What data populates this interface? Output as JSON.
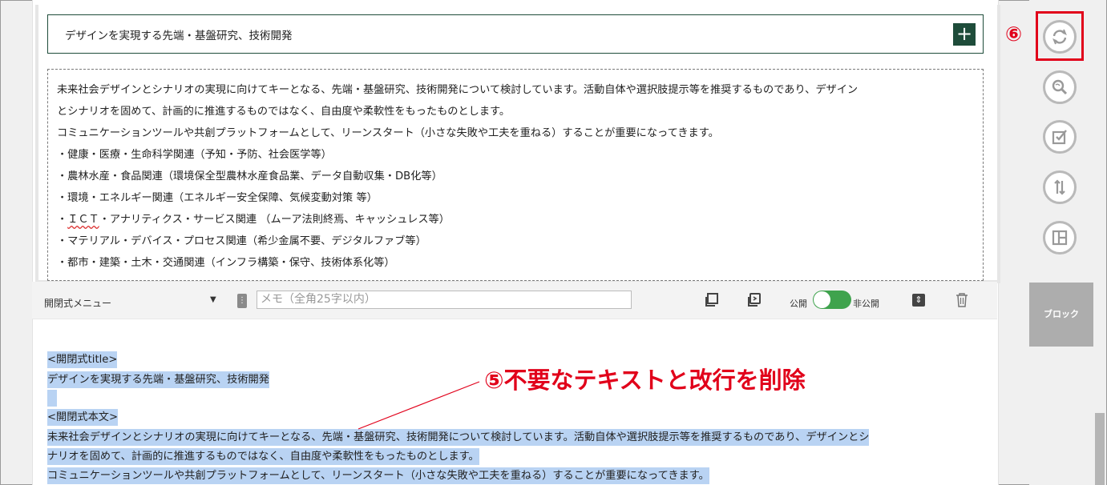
{
  "accordion": {
    "title": "デザインを実現する先端・基盤研究、技術開発",
    "expand_icon": "+",
    "body_lines": [
      "未来社会デザインとシナリオの実現に向けてキーとなる、先端・基盤研究、技術開発について検討しています。活動自体や選択肢提示等を推奨するものであり、デザイン",
      "とシナリオを固めて、計画的に推進するものではなく、自由度や柔軟性をもったものとします。",
      "コミュニケーションツールや共創プラットフォームとして、リーンスタート（小さな失敗や工夫を重ねる）することが重要になってきます。",
      "・健康・医療・生命科学関連（予知・予防、社会医学等）",
      "・農林水産・食品関連（環境保全型農林水産食品業、データ自動収集・DB化等）",
      "・環境・エネルギー関連（エネルギー安全保障、気候変動対策 等）"
    ],
    "ict_line": {
      "prefix": "・",
      "underlined": "ＩＣＴ",
      "rest": "・アナリティクス・サービス関連 （ムーア法則終焉、キャッシュレス等）"
    },
    "body_lines_after": [
      "・マテリアル・デバイス・プロセス関連（希少金属不要、デジタルファブ等）",
      "・都市・建築・土木・交通関連（インフラ構築・保守、技術体系化等）"
    ]
  },
  "toolbar": {
    "block_type": "開閉式メニュー",
    "memo_placeholder": "メモ（全角25字以内）",
    "memo_value": "",
    "public_label": "公開",
    "private_label": "非公開",
    "toggle_on": true
  },
  "text_editor": {
    "lines": [
      "<開閉式title>",
      "デザインを実現する先端・基盤研究、技術開発",
      "<開閉式本文>",
      "未来社会デザインとシナリオの実現に向けてキーとなる、先端・基盤研究、技術開発について検討しています。活動自体や選択肢提示等を推奨するものであり、デザインとシ",
      "ナリオを固めて、計画的に推進するものではなく、自由度や柔軟性をもったものとします。",
      "コミュニケーションツールや共創プラットフォームとして、リーンスタート（小さな失敗や工夫を重ねる）することが重要になってきます。"
    ]
  },
  "right_rail": {
    "buttons": [
      "refresh-icon",
      "zoom-icon",
      "checklist-icon",
      "sort-icon",
      "layout-icon"
    ],
    "block_label": "ブロック"
  },
  "annotations": {
    "step6": "⑥",
    "step5": "⑤不要なテキストと改行を削除"
  },
  "colors": {
    "accent_green": "#1e4c3a",
    "toggle_green": "#3fa34d",
    "annotation_red": "#e1001a",
    "selection_blue": "#b9d3f3"
  }
}
